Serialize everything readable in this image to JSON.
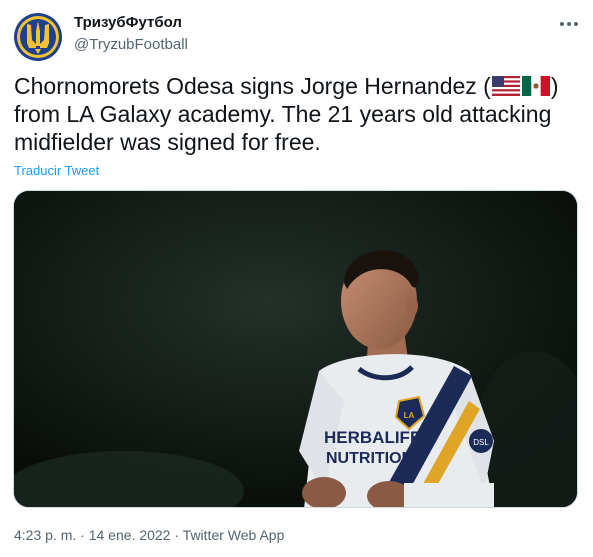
{
  "author": {
    "display_name": "ТризубФутбол",
    "handle": "@TryzubFootball"
  },
  "tweet": {
    "text_before_flags": "Chornomorets Odesa signs Jorge Hernandez (",
    "flags": [
      "flag-usa-icon",
      "flag-mexico-icon"
    ],
    "text_after_flags": ") from LA Galaxy academy. The 21 years old attacking midfielder was signed for free.",
    "translate_label": "Traducir Tweet"
  },
  "media": {
    "kit_text": [
      "HERBALIFE",
      "NUTRITION"
    ],
    "badge_text": "LA",
    "sleeve_patch": "DSL"
  },
  "meta": {
    "time": "4:23 p. m.",
    "separator": " · ",
    "date": "14 ene. 2022",
    "source": "Twitter Web App"
  },
  "colors": {
    "accent": "#1d9bf0",
    "text": "#0f1419",
    "muted": "#536471",
    "avatar_blue": "#1f3f8f",
    "avatar_gold": "#f2c230"
  }
}
